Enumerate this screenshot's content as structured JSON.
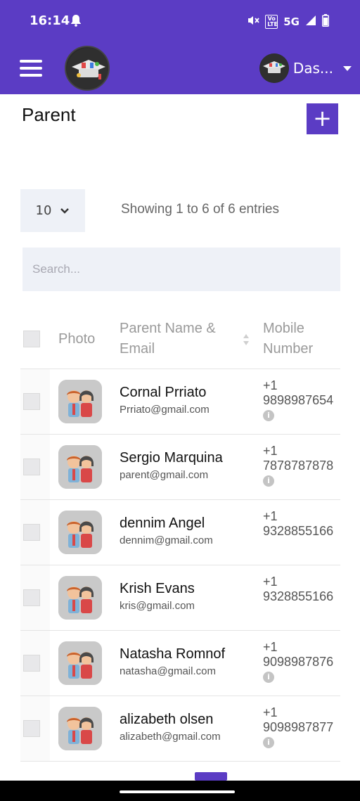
{
  "status_bar": {
    "time": "16:14",
    "network": "5G",
    "volte": "Vo LTE"
  },
  "header": {
    "user_name": "Das..."
  },
  "page": {
    "title": "Parent",
    "add_label": "+"
  },
  "table_controls": {
    "page_length": "10",
    "info_text": "Showing 1 to 6 of 6 entries",
    "search_placeholder": "Search..."
  },
  "table": {
    "columns": [
      "Photo",
      "Parent Name & Email",
      "Mobile Number"
    ],
    "rows": [
      {
        "name": "Cornal Prriato",
        "email": "Prriato@gmail.com",
        "code": "+1",
        "mobile": "9898987654"
      },
      {
        "name": "Sergio Marquina",
        "email": "parent@gmail.com",
        "code": "+1",
        "mobile": "7878787878"
      },
      {
        "name": "dennim Angel",
        "email": "dennim@gmail.com",
        "code": "+1",
        "mobile": "9328855166"
      },
      {
        "name": "Krish Evans",
        "email": "kris@gmail.com",
        "code": "+1",
        "mobile": "9328855166"
      },
      {
        "name": "Natasha Romnof",
        "email": "natasha@gmail.com",
        "code": "+1",
        "mobile": "9098987876"
      },
      {
        "name": "alizabeth olsen",
        "email": "alizabeth@gmail.com",
        "code": "+1",
        "mobile": "9098987877"
      }
    ]
  },
  "colors": {
    "primary": "#5b3cc4",
    "input_bg": "#eef1f7"
  },
  "icons": [
    "bell-icon",
    "mute-icon",
    "signal-icon",
    "battery-icon",
    "menu-icon",
    "chevron-down-icon",
    "sort-icon",
    "info-icon",
    "parent-avatar-icon"
  ]
}
